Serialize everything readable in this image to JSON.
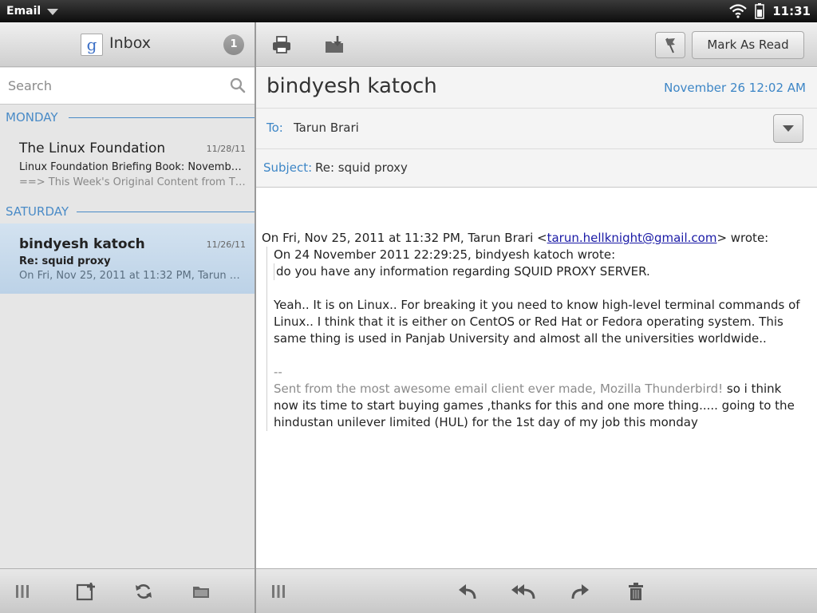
{
  "status_bar": {
    "app_name": "Email",
    "time": "11:31"
  },
  "inbox": {
    "account_icon_letter": "g",
    "title": "Inbox",
    "unread_count": "1"
  },
  "search": {
    "placeholder": "Search"
  },
  "groups": [
    {
      "label": "MONDAY",
      "messages": [
        {
          "sender": "The Linux Foundation",
          "date": "11/28/11",
          "subject": "Linux Foundation Briefing Book: November 2...",
          "preview": "==> This Week's Original Content from The ..."
        }
      ]
    },
    {
      "label": "SATURDAY",
      "messages": [
        {
          "sender": "bindyesh katoch",
          "date": "11/26/11",
          "subject": "Re: squid proxy",
          "preview": "On Fri, Nov 25, 2011 at 11:32 PM, Tarun Brar..."
        }
      ]
    }
  ],
  "toolbar": {
    "mark_as_read": "Mark As Read"
  },
  "message": {
    "from": "bindyesh katoch",
    "datetime": "November 26 12:02 AM",
    "to_label": "To:",
    "to": "Tarun Brari",
    "subject_label": "Subject:",
    "subject": "Re: squid proxy",
    "body": {
      "attribution_prefix": "On Fri, Nov 25, 2011 at 11:32 PM, Tarun Brari <",
      "attribution_email": "tarun.hellknight@gmail.com",
      "attribution_suffix": "> wrote:",
      "quote_attribution": "On 24 November 2011 22:29:25, bindyesh katoch wrote:",
      "quote_inner": "do you have any information regarding SQUID PROXY SERVER.",
      "reply_paragraph": "Yeah.. It is on Linux.. For breaking it you need to know high-level terminal commands of Linux.. I think that it is either on CentOS or Red Hat or Fedora operating system. This same thing is used in Panjab University and almost all the universities worldwide..",
      "signature_dashes": "--",
      "signature": "Sent from the most awesome email client ever made, Mozilla Thunderbird!",
      "latest_reply": " so i think now its time to start buying games ,thanks for this and one more thing..... going to the hindustan unilever limited (HUL) for the 1st day of my job this monday"
    }
  },
  "colors": {
    "accent_blue": "#3d86c6",
    "link": "#1a1aa6",
    "selected_row": "#c8dbed"
  }
}
